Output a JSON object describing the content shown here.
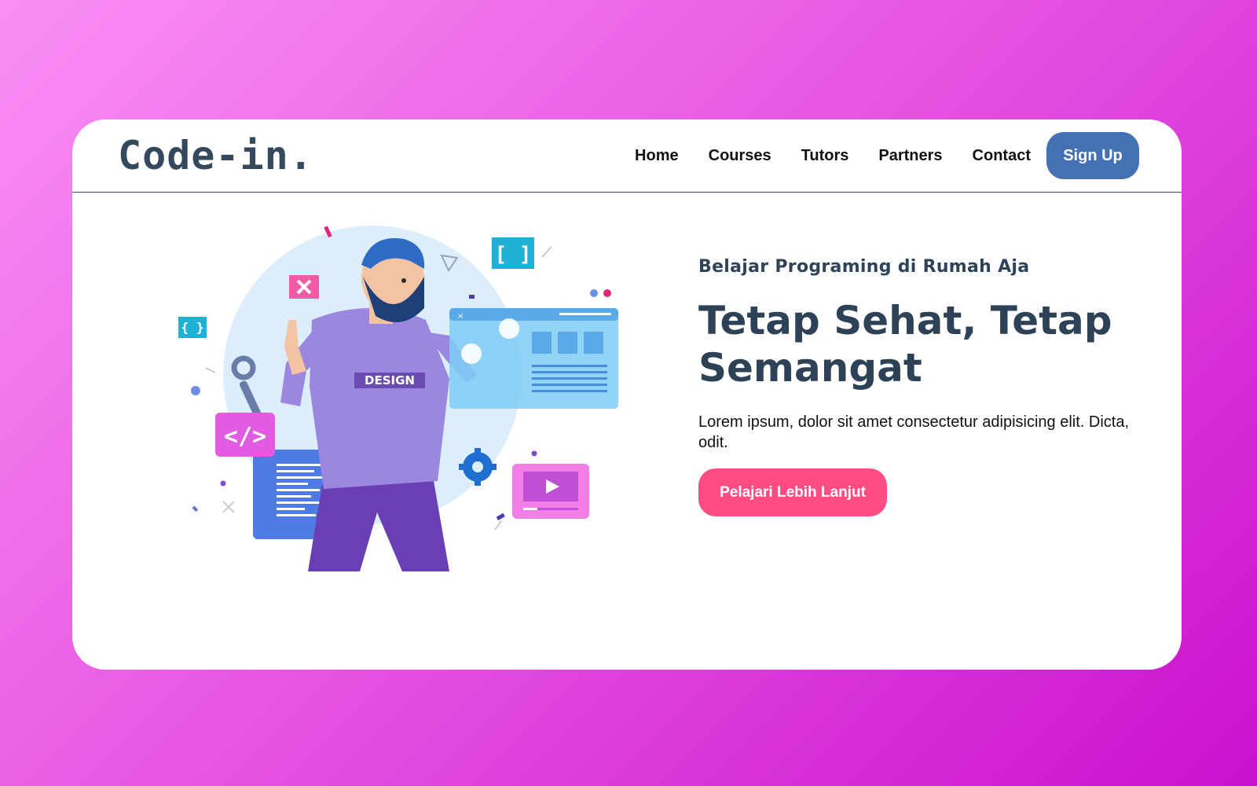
{
  "brand": {
    "logo": "Code-in."
  },
  "nav": {
    "items": [
      {
        "label": "Home"
      },
      {
        "label": "Courses"
      },
      {
        "label": "Tutors"
      },
      {
        "label": "Partners"
      },
      {
        "label": "Contact"
      }
    ],
    "signup_label": "Sign Up"
  },
  "hero": {
    "subtitle": "Belajar Programing di Rumah Aja",
    "headline": "Tetap Sehat, Tetap Semangat",
    "description": "Lorem ipsum, dolor sit amet consectetur adipisicing elit. Dicta, odit.",
    "cta_label": "Pelajari Lebih Lanjut",
    "illustration": {
      "shirt_text": "DESIGN",
      "icons": [
        "close-icon",
        "code-icon",
        "brackets-icon",
        "gear-icon",
        "play-icon",
        "wrench-icon",
        "document-icon",
        "browser-window-icon"
      ]
    }
  },
  "colors": {
    "background_start": "#f98ff5",
    "background_end": "#c911cf",
    "brand_text": "#34485e",
    "signup_button": "#4471b4",
    "cta_button": "#ff4d83"
  }
}
